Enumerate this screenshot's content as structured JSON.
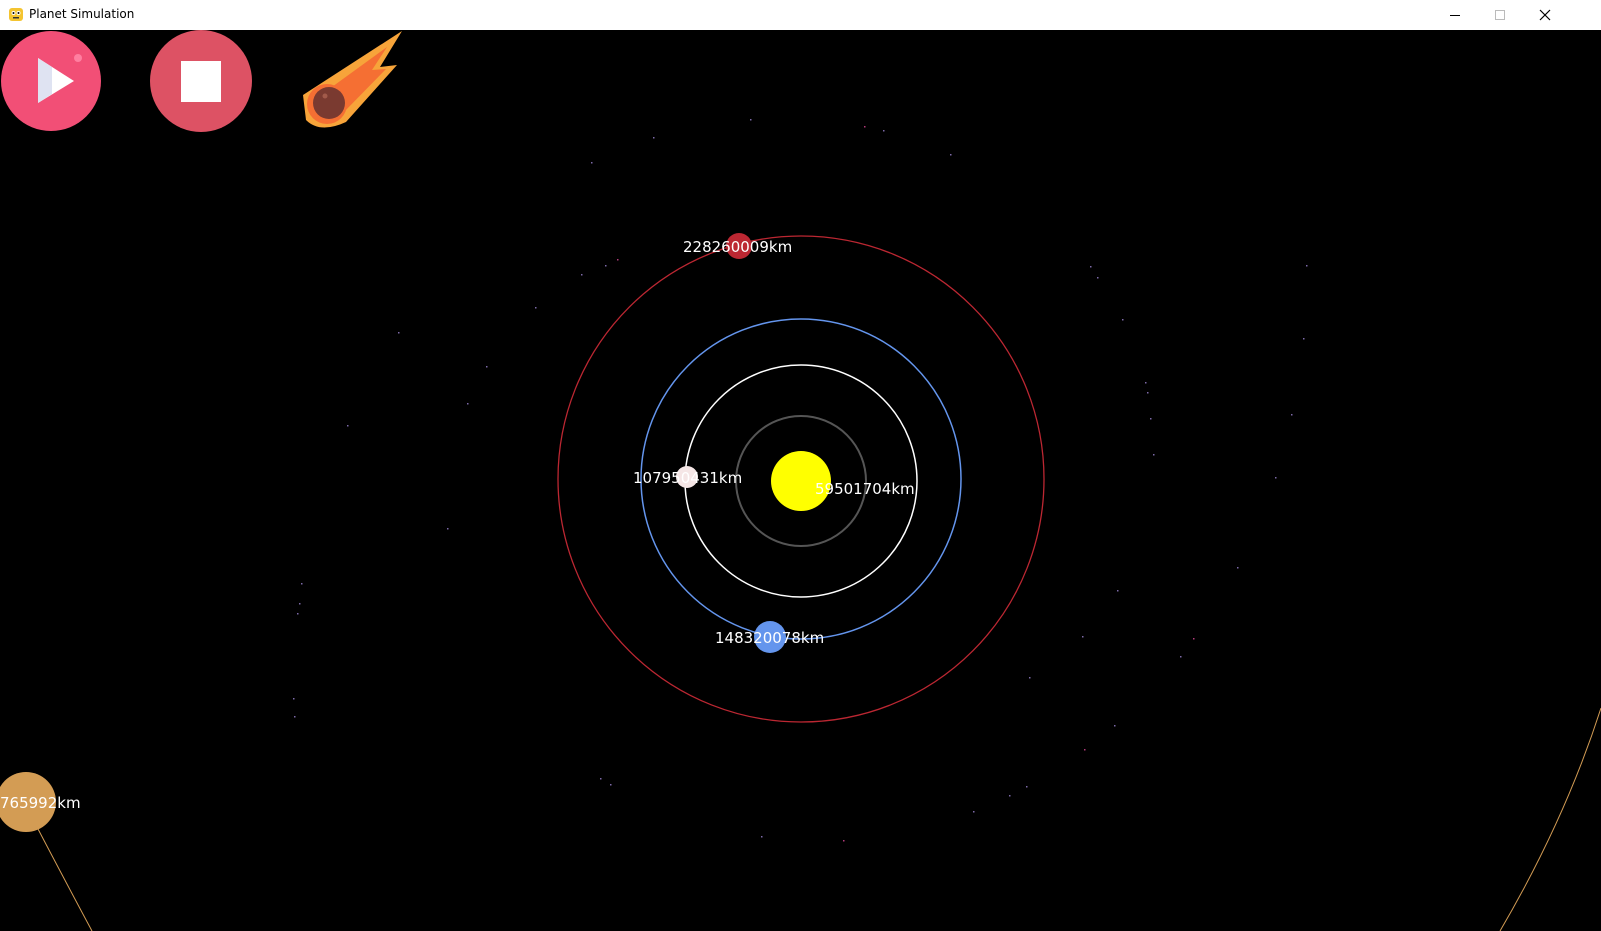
{
  "window": {
    "title": "Planet Simulation",
    "controls": {
      "minimize": "minimize-icon",
      "maximize": "maximize-icon",
      "close": "close-icon"
    }
  },
  "toolbar": {
    "buttons": [
      {
        "name": "play-button",
        "icon": "play-icon",
        "color": "#f24f76"
      },
      {
        "name": "stop-button",
        "icon": "stop-icon",
        "color": "#dd5264"
      },
      {
        "name": "comet-button",
        "icon": "comet-icon",
        "color": "#f7a43a"
      }
    ]
  },
  "simulation": {
    "background": "#000000",
    "sun": {
      "color": "#ffff00"
    },
    "planets": [
      {
        "name": "mercury",
        "distance_label": "59501704km",
        "color": "#555555",
        "orbit_color": "#555555"
      },
      {
        "name": "venus",
        "distance_label": "107950431km",
        "color": "#f5e6e6",
        "orbit_color": "#ffffff"
      },
      {
        "name": "earth",
        "distance_label": "148320078km",
        "color": "#6495ed",
        "orbit_color": "#6495ed"
      },
      {
        "name": "mars",
        "distance_label": "228260009km",
        "color": "#bc2732",
        "orbit_color": "#bc2732"
      },
      {
        "name": "jupiter",
        "distance_label": "765992km",
        "color": "#d39c54",
        "orbit_color": "#d39c54"
      }
    ]
  }
}
